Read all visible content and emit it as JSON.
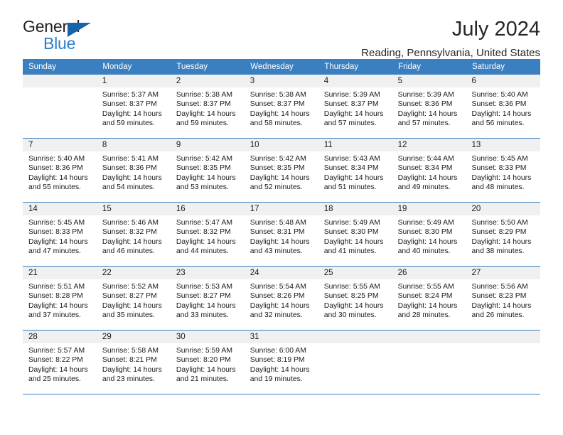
{
  "brand": {
    "name_part1": "General",
    "name_part2": "Blue",
    "accent_color": "#2a7fc9",
    "triangle_color": "#1565a8"
  },
  "header": {
    "title": "July 2024",
    "subtitle": "Reading, Pennsylvania, United States",
    "header_bg_color": "#3a7fbf",
    "daynum_bg_color": "#f0f0f0"
  },
  "weekday_headers": [
    "Sunday",
    "Monday",
    "Tuesday",
    "Wednesday",
    "Thursday",
    "Friday",
    "Saturday"
  ],
  "weeks": [
    {
      "days": [
        {
          "date": "",
          "sunrise": "",
          "sunset": "",
          "daylight_line1": "",
          "daylight_line2": "",
          "empty": true
        },
        {
          "date": "1",
          "sunrise": "Sunrise: 5:37 AM",
          "sunset": "Sunset: 8:37 PM",
          "daylight_line1": "Daylight: 14 hours",
          "daylight_line2": "and 59 minutes.",
          "empty": false
        },
        {
          "date": "2",
          "sunrise": "Sunrise: 5:38 AM",
          "sunset": "Sunset: 8:37 PM",
          "daylight_line1": "Daylight: 14 hours",
          "daylight_line2": "and 59 minutes.",
          "empty": false
        },
        {
          "date": "3",
          "sunrise": "Sunrise: 5:38 AM",
          "sunset": "Sunset: 8:37 PM",
          "daylight_line1": "Daylight: 14 hours",
          "daylight_line2": "and 58 minutes.",
          "empty": false
        },
        {
          "date": "4",
          "sunrise": "Sunrise: 5:39 AM",
          "sunset": "Sunset: 8:37 PM",
          "daylight_line1": "Daylight: 14 hours",
          "daylight_line2": "and 57 minutes.",
          "empty": false
        },
        {
          "date": "5",
          "sunrise": "Sunrise: 5:39 AM",
          "sunset": "Sunset: 8:36 PM",
          "daylight_line1": "Daylight: 14 hours",
          "daylight_line2": "and 57 minutes.",
          "empty": false
        },
        {
          "date": "6",
          "sunrise": "Sunrise: 5:40 AM",
          "sunset": "Sunset: 8:36 PM",
          "daylight_line1": "Daylight: 14 hours",
          "daylight_line2": "and 56 minutes.",
          "empty": false
        }
      ]
    },
    {
      "days": [
        {
          "date": "7",
          "sunrise": "Sunrise: 5:40 AM",
          "sunset": "Sunset: 8:36 PM",
          "daylight_line1": "Daylight: 14 hours",
          "daylight_line2": "and 55 minutes.",
          "empty": false
        },
        {
          "date": "8",
          "sunrise": "Sunrise: 5:41 AM",
          "sunset": "Sunset: 8:36 PM",
          "daylight_line1": "Daylight: 14 hours",
          "daylight_line2": "and 54 minutes.",
          "empty": false
        },
        {
          "date": "9",
          "sunrise": "Sunrise: 5:42 AM",
          "sunset": "Sunset: 8:35 PM",
          "daylight_line1": "Daylight: 14 hours",
          "daylight_line2": "and 53 minutes.",
          "empty": false
        },
        {
          "date": "10",
          "sunrise": "Sunrise: 5:42 AM",
          "sunset": "Sunset: 8:35 PM",
          "daylight_line1": "Daylight: 14 hours",
          "daylight_line2": "and 52 minutes.",
          "empty": false
        },
        {
          "date": "11",
          "sunrise": "Sunrise: 5:43 AM",
          "sunset": "Sunset: 8:34 PM",
          "daylight_line1": "Daylight: 14 hours",
          "daylight_line2": "and 51 minutes.",
          "empty": false
        },
        {
          "date": "12",
          "sunrise": "Sunrise: 5:44 AM",
          "sunset": "Sunset: 8:34 PM",
          "daylight_line1": "Daylight: 14 hours",
          "daylight_line2": "and 49 minutes.",
          "empty": false
        },
        {
          "date": "13",
          "sunrise": "Sunrise: 5:45 AM",
          "sunset": "Sunset: 8:33 PM",
          "daylight_line1": "Daylight: 14 hours",
          "daylight_line2": "and 48 minutes.",
          "empty": false
        }
      ]
    },
    {
      "days": [
        {
          "date": "14",
          "sunrise": "Sunrise: 5:45 AM",
          "sunset": "Sunset: 8:33 PM",
          "daylight_line1": "Daylight: 14 hours",
          "daylight_line2": "and 47 minutes.",
          "empty": false
        },
        {
          "date": "15",
          "sunrise": "Sunrise: 5:46 AM",
          "sunset": "Sunset: 8:32 PM",
          "daylight_line1": "Daylight: 14 hours",
          "daylight_line2": "and 46 minutes.",
          "empty": false
        },
        {
          "date": "16",
          "sunrise": "Sunrise: 5:47 AM",
          "sunset": "Sunset: 8:32 PM",
          "daylight_line1": "Daylight: 14 hours",
          "daylight_line2": "and 44 minutes.",
          "empty": false
        },
        {
          "date": "17",
          "sunrise": "Sunrise: 5:48 AM",
          "sunset": "Sunset: 8:31 PM",
          "daylight_line1": "Daylight: 14 hours",
          "daylight_line2": "and 43 minutes.",
          "empty": false
        },
        {
          "date": "18",
          "sunrise": "Sunrise: 5:49 AM",
          "sunset": "Sunset: 8:30 PM",
          "daylight_line1": "Daylight: 14 hours",
          "daylight_line2": "and 41 minutes.",
          "empty": false
        },
        {
          "date": "19",
          "sunrise": "Sunrise: 5:49 AM",
          "sunset": "Sunset: 8:30 PM",
          "daylight_line1": "Daylight: 14 hours",
          "daylight_line2": "and 40 minutes.",
          "empty": false
        },
        {
          "date": "20",
          "sunrise": "Sunrise: 5:50 AM",
          "sunset": "Sunset: 8:29 PM",
          "daylight_line1": "Daylight: 14 hours",
          "daylight_line2": "and 38 minutes.",
          "empty": false
        }
      ]
    },
    {
      "days": [
        {
          "date": "21",
          "sunrise": "Sunrise: 5:51 AM",
          "sunset": "Sunset: 8:28 PM",
          "daylight_line1": "Daylight: 14 hours",
          "daylight_line2": "and 37 minutes.",
          "empty": false
        },
        {
          "date": "22",
          "sunrise": "Sunrise: 5:52 AM",
          "sunset": "Sunset: 8:27 PM",
          "daylight_line1": "Daylight: 14 hours",
          "daylight_line2": "and 35 minutes.",
          "empty": false
        },
        {
          "date": "23",
          "sunrise": "Sunrise: 5:53 AM",
          "sunset": "Sunset: 8:27 PM",
          "daylight_line1": "Daylight: 14 hours",
          "daylight_line2": "and 33 minutes.",
          "empty": false
        },
        {
          "date": "24",
          "sunrise": "Sunrise: 5:54 AM",
          "sunset": "Sunset: 8:26 PM",
          "daylight_line1": "Daylight: 14 hours",
          "daylight_line2": "and 32 minutes.",
          "empty": false
        },
        {
          "date": "25",
          "sunrise": "Sunrise: 5:55 AM",
          "sunset": "Sunset: 8:25 PM",
          "daylight_line1": "Daylight: 14 hours",
          "daylight_line2": "and 30 minutes.",
          "empty": false
        },
        {
          "date": "26",
          "sunrise": "Sunrise: 5:55 AM",
          "sunset": "Sunset: 8:24 PM",
          "daylight_line1": "Daylight: 14 hours",
          "daylight_line2": "and 28 minutes.",
          "empty": false
        },
        {
          "date": "27",
          "sunrise": "Sunrise: 5:56 AM",
          "sunset": "Sunset: 8:23 PM",
          "daylight_line1": "Daylight: 14 hours",
          "daylight_line2": "and 26 minutes.",
          "empty": false
        }
      ]
    },
    {
      "days": [
        {
          "date": "28",
          "sunrise": "Sunrise: 5:57 AM",
          "sunset": "Sunset: 8:22 PM",
          "daylight_line1": "Daylight: 14 hours",
          "daylight_line2": "and 25 minutes.",
          "empty": false
        },
        {
          "date": "29",
          "sunrise": "Sunrise: 5:58 AM",
          "sunset": "Sunset: 8:21 PM",
          "daylight_line1": "Daylight: 14 hours",
          "daylight_line2": "and 23 minutes.",
          "empty": false
        },
        {
          "date": "30",
          "sunrise": "Sunrise: 5:59 AM",
          "sunset": "Sunset: 8:20 PM",
          "daylight_line1": "Daylight: 14 hours",
          "daylight_line2": "and 21 minutes.",
          "empty": false
        },
        {
          "date": "31",
          "sunrise": "Sunrise: 6:00 AM",
          "sunset": "Sunset: 8:19 PM",
          "daylight_line1": "Daylight: 14 hours",
          "daylight_line2": "and 19 minutes.",
          "empty": false
        },
        {
          "date": "",
          "sunrise": "",
          "sunset": "",
          "daylight_line1": "",
          "daylight_line2": "",
          "empty": true
        },
        {
          "date": "",
          "sunrise": "",
          "sunset": "",
          "daylight_line1": "",
          "daylight_line2": "",
          "empty": true
        },
        {
          "date": "",
          "sunrise": "",
          "sunset": "",
          "daylight_line1": "",
          "daylight_line2": "",
          "empty": true
        }
      ]
    }
  ]
}
